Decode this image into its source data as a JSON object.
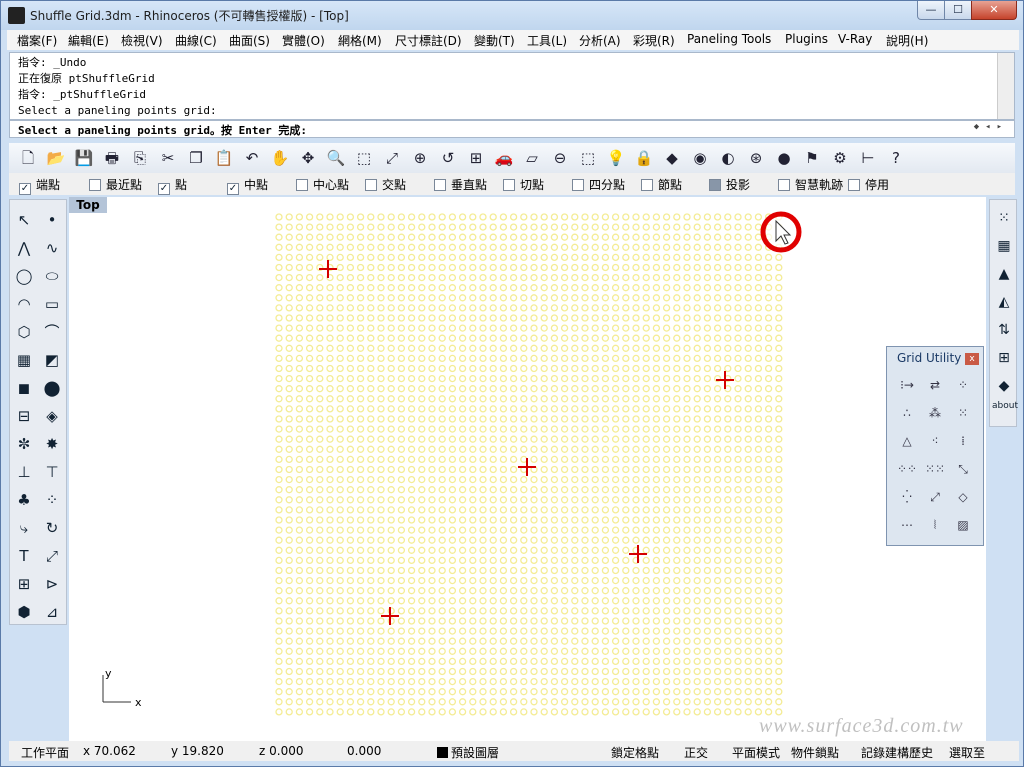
{
  "window": {
    "title": "Shuffle Grid.3dm - Rhinoceros (不可轉售授權版) - [Top]",
    "min": "—",
    "max": "☐",
    "close": "✕"
  },
  "menu": [
    "檔案(F)",
    "編輯(E)",
    "檢視(V)",
    "曲線(C)",
    "曲面(S)",
    "實體(O)",
    "網格(M)",
    "尺寸標註(D)",
    "變動(T)",
    "工具(L)",
    "分析(A)",
    "彩現(R)",
    "Paneling Tools",
    "Plugins",
    "V-Ray",
    "說明(H)"
  ],
  "command_history": [
    "指令: _Undo",
    "正在復原 ptShuffleGrid",
    "指令: _ptShuffleGrid",
    "Select a paneling points grid:"
  ],
  "command_prompt": "Select a paneling points grid。按 Enter 完成:",
  "osnaps": [
    {
      "label": "端點",
      "checked": true
    },
    {
      "label": "最近點",
      "checked": false
    },
    {
      "label": "點",
      "checked": true
    },
    {
      "label": "中點",
      "checked": true
    },
    {
      "label": "中心點",
      "checked": false
    },
    {
      "label": "交點",
      "checked": false
    },
    {
      "label": "垂直點",
      "checked": false
    },
    {
      "label": "切點",
      "checked": false
    },
    {
      "label": "四分點",
      "checked": false
    },
    {
      "label": "節點",
      "checked": false
    },
    {
      "label": "投影",
      "checked": false
    },
    {
      "label": "智慧軌跡",
      "checked": false
    },
    {
      "label": "停用",
      "checked": false
    }
  ],
  "viewport": {
    "label": "Top",
    "axis_y": "y",
    "axis_x": "x"
  },
  "grid_utility": {
    "title": "Grid Utility",
    "close": "x"
  },
  "right_toolbar": {
    "about_label": "about"
  },
  "status": {
    "plane": "工作平面",
    "x": "x 70.062",
    "y": "y 19.820",
    "z": "z 0.000",
    "w": "0.000",
    "layer": "預設圖層",
    "snap": "鎖定格點",
    "ortho": "正交",
    "planar": "平面模式",
    "osnap": "物件鎖點",
    "history": "記錄建構歷史",
    "filter": "選取至"
  },
  "watermark": "www.surface3d.com.tw",
  "colors": {
    "points": "#f4ec95",
    "crosshair": "#d40000",
    "cursor_ring": "#e00000"
  }
}
